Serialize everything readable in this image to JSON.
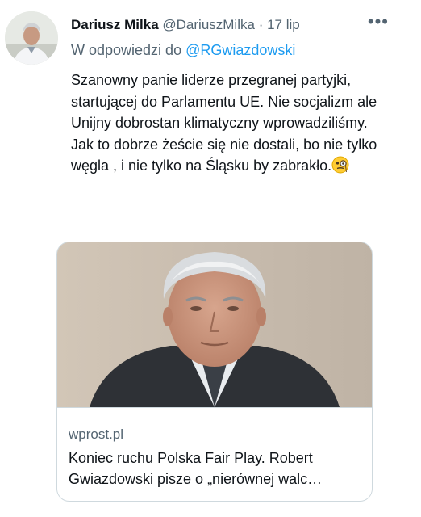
{
  "tweet": {
    "author_name": "Dariusz Milka",
    "author_handle": "@DariuszMilka",
    "separator": "·",
    "date": "17 lip",
    "more_icon": "more-horizontal-icon",
    "reply_prefix": "W odpowiedzi do",
    "reply_handle": "@RGwiazdowski",
    "text_lines": [
      "Szanowny panie liderze przegranej partyjki, startującej do Parlamentu UE. Nie socjalizm ale Unijny dobrostan klimatyczny wprowadziliśmy.",
      "Jak to dobrze żeście się nie dostali, bo nie tylko węgla , i nie tylko na Śląsku by zabrakło."
    ],
    "emoji_icon": "face-with-monocle-icon"
  },
  "card": {
    "domain": "wprost.pl",
    "title": "Koniec ruchu Polska Fair Play. Robert Gwiazdowski pisze o „nierównej walc…"
  },
  "colors": {
    "text": "#0f1419",
    "secondary": "#536471",
    "link": "#1d9bf0",
    "border": "#cfd9de"
  }
}
